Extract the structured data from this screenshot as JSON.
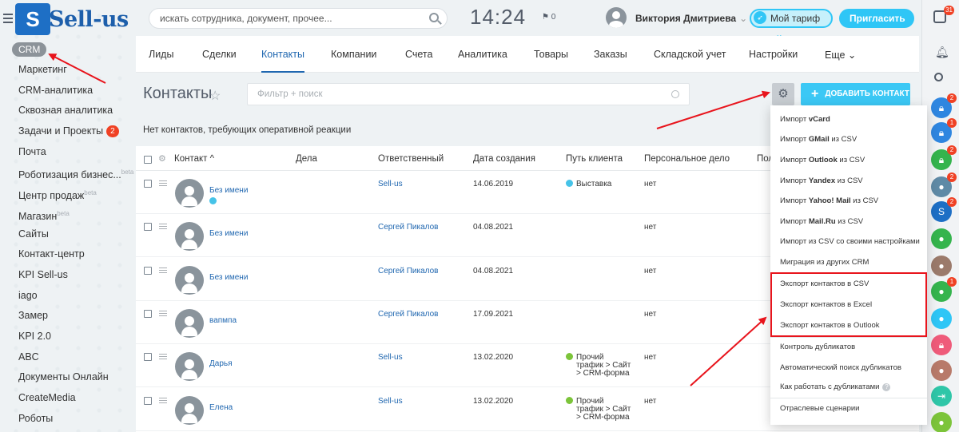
{
  "app": {
    "logo_text": "Sell-us",
    "clock": "14:24",
    "flag_count": "0"
  },
  "header": {
    "search_placeholder": "искать сотрудника, документ, прочее...",
    "user_name": "Виктория Дмитриева",
    "tariff_label": "Мой тариф",
    "invite_label": "Пригласить"
  },
  "sidebar": {
    "items": [
      {
        "label": "CRM",
        "active": true
      },
      {
        "label": "Маркетинг"
      },
      {
        "label": "CRM-аналитика"
      },
      {
        "label": "Сквозная аналитика"
      },
      {
        "label": "Задачи и Проекты",
        "badge": "2"
      },
      {
        "label": "Почта"
      },
      {
        "label": "Роботизация бизнес...",
        "sup": "beta"
      },
      {
        "label": "Центр продаж",
        "sup": "beta"
      },
      {
        "label": "Магазин",
        "sup": "beta"
      },
      {
        "label": "Сайты"
      },
      {
        "label": "Контакт-центр"
      },
      {
        "label": "KPI Sell-us"
      },
      {
        "label": "iago"
      },
      {
        "label": "Замер"
      },
      {
        "label": "KPI 2.0"
      },
      {
        "label": "ABC"
      },
      {
        "label": "Документы Онлайн"
      },
      {
        "label": "CreateMedia"
      },
      {
        "label": "Роботы"
      }
    ]
  },
  "tabs": [
    {
      "label": "Лиды"
    },
    {
      "label": "Сделки"
    },
    {
      "label": "Контакты",
      "active": true
    },
    {
      "label": "Компании"
    },
    {
      "label": "Счета"
    },
    {
      "label": "Аналитика"
    },
    {
      "label": "Товары"
    },
    {
      "label": "Заказы"
    },
    {
      "label": "Складской учет"
    },
    {
      "label": "Настройки"
    },
    {
      "label": "Еще ⌄"
    }
  ],
  "page": {
    "title": "Контакты",
    "filter_placeholder": "Фильтр + поиск",
    "add_button": "ДОБАВИТЬ КОНТАКТ",
    "notice": "Нет контактов, требующих оперативной реакции"
  },
  "grid": {
    "columns": [
      "Контакт ^",
      "Дела",
      "Ответственный",
      "Дата создания",
      "Путь клиента",
      "Персональное дело",
      "Пол"
    ],
    "rows": [
      {
        "name": "Без имени",
        "resp": "Sell-us",
        "date": "14.06.2019",
        "path": "Выставка",
        "path_color": "#46c3e8",
        "deal": "нет",
        "badge": true
      },
      {
        "name": "Без имени",
        "resp": "Сергей Пикалов",
        "date": "04.08.2021",
        "path": "",
        "deal": "нет"
      },
      {
        "name": "Без имени",
        "resp": "Сергей Пикалов",
        "date": "04.08.2021",
        "path": "",
        "deal": "нет"
      },
      {
        "name": "вапмпа",
        "resp": "Сергей Пикалов",
        "date": "17.09.2021",
        "path": "",
        "deal": "нет"
      },
      {
        "name": "Дарья",
        "resp": "Sell-us",
        "date": "13.02.2020",
        "path_lines": [
          "Прочий",
          "трафик > Сайт",
          "> CRM-форма"
        ],
        "path_color": "#7cc43a",
        "deal": "нет"
      },
      {
        "name": "Елена",
        "resp": "Sell-us",
        "date": "13.02.2020",
        "path_lines": [
          "Прочий",
          "трафик > Сайт",
          "> CRM-форма"
        ],
        "path_color": "#7cc43a",
        "deal": "нет"
      }
    ]
  },
  "dropdown": {
    "items": [
      {
        "pre": "Импорт ",
        "bold": "vCard",
        "post": ""
      },
      {
        "pre": "Импорт ",
        "bold": "GMail",
        "post": " из CSV"
      },
      {
        "pre": "Импорт ",
        "bold": "Outlook",
        "post": " из CSV"
      },
      {
        "pre": "Импорт ",
        "bold": "Yandex",
        "post": " из CSV"
      },
      {
        "pre": "Импорт ",
        "bold": "Yahoo! Mail",
        "post": " из CSV"
      },
      {
        "pre": "Импорт ",
        "bold": "Mail.Ru",
        "post": " из CSV"
      },
      {
        "pre": "Импорт из CSV со своими настройками",
        "bold": "",
        "post": ""
      },
      {
        "pre": "Миграция из других CRM",
        "bold": "",
        "post": ""
      },
      {
        "pre": "Экспорт контактов в CSV",
        "bold": "",
        "post": ""
      },
      {
        "pre": "Экспорт контактов в Excel",
        "bold": "",
        "post": ""
      },
      {
        "pre": "Экспорт контактов в Outlook",
        "bold": "",
        "post": ""
      },
      {
        "pre": "Контроль дубликатов",
        "bold": "",
        "post": ""
      },
      {
        "pre": "Автоматический поиск дубликатов",
        "bold": "",
        "post": ""
      },
      {
        "pre": "Как работать с дубликатами",
        "bold": "",
        "post": "",
        "help": true
      },
      {
        "pre": "Отраслевые сценарии",
        "bold": "",
        "post": ""
      }
    ]
  },
  "right_panel": {
    "top_badge": "31",
    "items": [
      {
        "color": "#2f86e0",
        "badge": "2",
        "icon": "lock-icon"
      },
      {
        "color": "#2f86e0",
        "badge": "1",
        "icon": "lock-icon"
      },
      {
        "color": "#35b44d",
        "badge": "2",
        "icon": "lock-icon"
      },
      {
        "color": "#5f8aa6",
        "badge": "2",
        "icon": "satellite-icon"
      },
      {
        "color": "#1e6fc5",
        "badge": "2",
        "icon": "logo-icon"
      },
      {
        "color": "#35b44d",
        "badge": "",
        "icon": "user-icon"
      },
      {
        "color": "#9b7a6b",
        "badge": "",
        "icon": "photo-icon"
      },
      {
        "color": "#35b44d",
        "badge": "1",
        "icon": "user-icon"
      },
      {
        "color": "#2fc6f6",
        "badge": "",
        "icon": "user-clock-icon"
      },
      {
        "color": "#ef5b7a",
        "badge": "",
        "icon": "lock-icon"
      },
      {
        "color": "#b87a6a",
        "badge": "",
        "icon": "user-icon"
      },
      {
        "color": "#2fc6a8",
        "badge": "",
        "icon": "exit-icon"
      },
      {
        "color": "#7cc43a",
        "badge": "",
        "icon": "user-icon"
      }
    ]
  }
}
